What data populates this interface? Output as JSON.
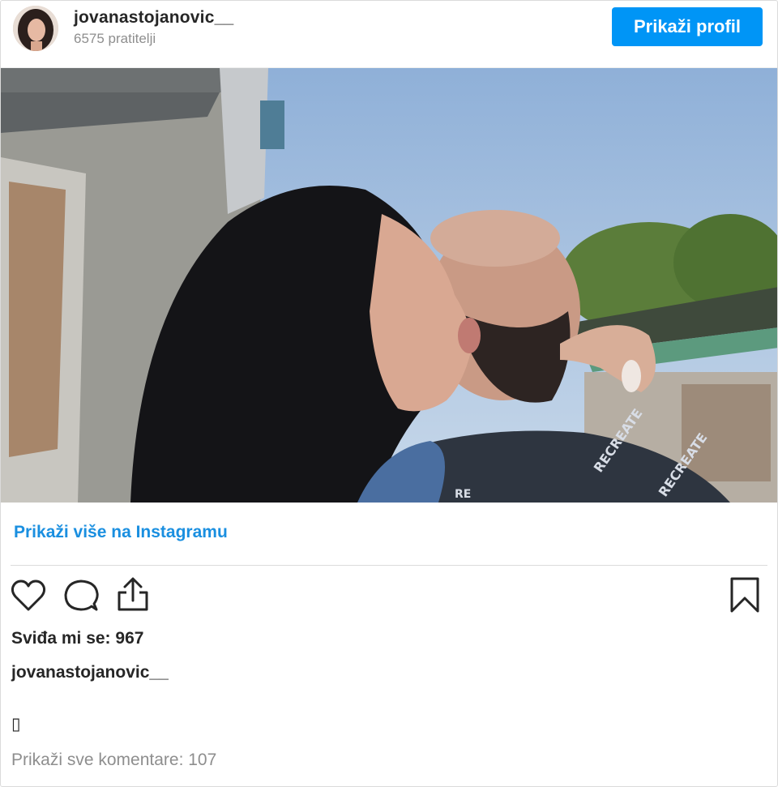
{
  "header": {
    "username": "jovanastojanovic__",
    "followers": "6575 pratitelji",
    "profile_button": "Prikaži profil"
  },
  "post": {
    "view_more_label": "Prikaži više na Instagramu",
    "likes": "Sviđa mi se: 967",
    "caption_username": "jovanastojanovic__",
    "caption_text": "▯",
    "comments_link": "Prikaži sve komentare: 107"
  },
  "icons": {
    "like": "heart-icon",
    "comment": "comment-icon",
    "share": "share-icon",
    "save": "bookmark-icon"
  },
  "colors": {
    "accent": "#0095f6",
    "link": "#1a8fe0",
    "muted": "#8e8e8e",
    "text": "#262626"
  }
}
